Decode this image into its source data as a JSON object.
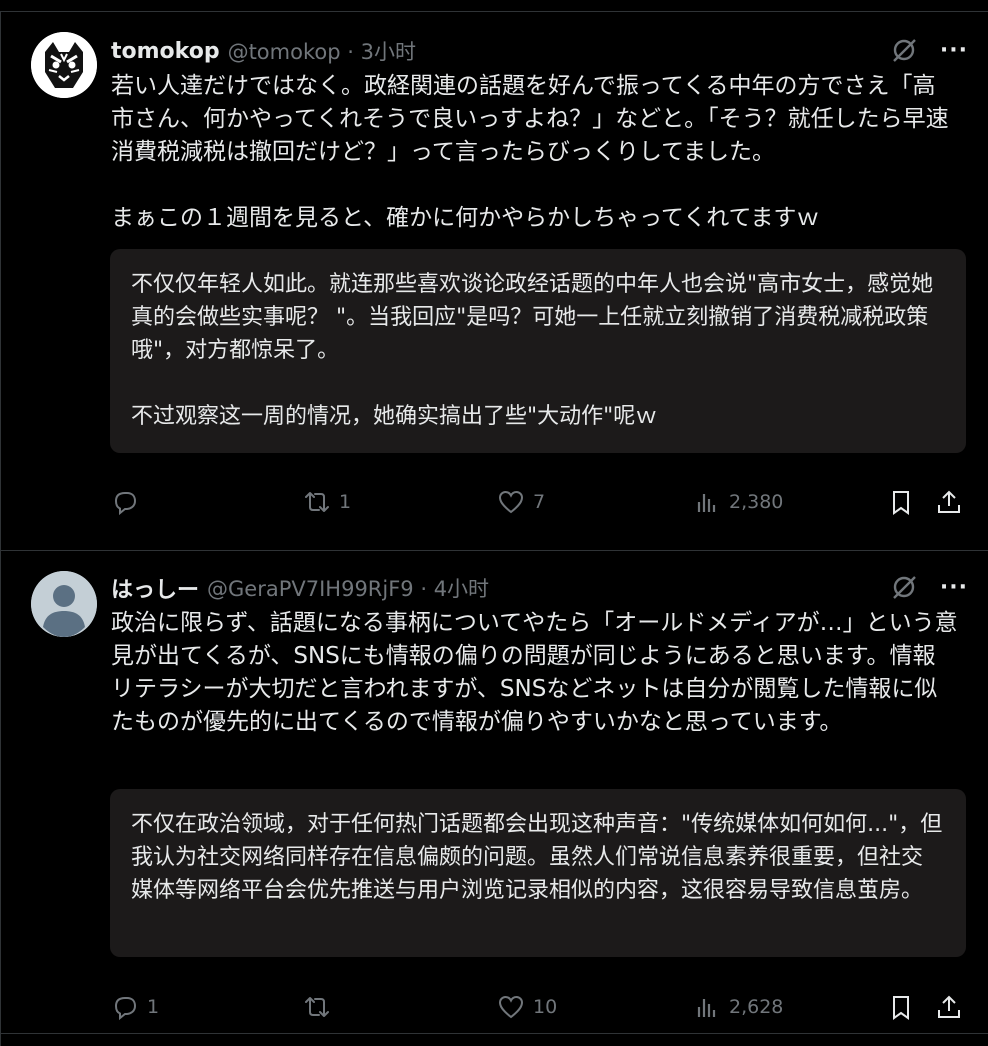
{
  "posts": [
    {
      "name": "tomokop",
      "handle_time": "@tomokop · 3小时",
      "text": "若い人達だけではなく。政経関連の話題を好んで振ってくる中年の方でさえ「高市さん、何かやってくれそうで良いっすよね？」などと。「そう？就任したら早速消費税減税は撤回だけど？」って言ったらびっくりしてました。\n\nまぁこの１週間を見ると、確かに何かやらかしちゃってくれてますｗ",
      "translation": "不仅仅年轻人如此。就连那些喜欢谈论政经话题的中年人也会说\"高市女士，感觉她真的会做些实事呢？ \"。当我回应\"是吗？可她一上任就立刻撤销了消费税减税政策哦\"，对方都惊呆了。\n\n不过观察这一周的情况，她确实搞出了些\"大动作\"呢ｗ",
      "replies": "",
      "reposts": "1",
      "likes": "7",
      "views": "2,380"
    },
    {
      "name": "はっしー",
      "handle_time": "@GeraPV7IH99RjF9 · 4小时",
      "text": "政治に限らず、話題になる事柄についてやたら「オールドメディアが…」という意見が出てくるが、SNSにも情報の偏りの問題が同じようにあると思います。情報リテラシーが大切だと言われますが、SNSなどネットは自分が閲覧した情報に似たものが優先的に出てくるので情報が偏りやすいかなと思っています。",
      "translation": "不仅在政治领域，对于任何热门话题都会出现这种声音：\"传统媒体如何如何...\"，但我认为社交网络同样存在信息偏颇的问题。虽然人们常说信息素养很重要，但社交媒体等网络平台会优先推送与用户浏览记录相似的内容，这很容易导致信息茧房。",
      "replies": "1",
      "reposts": "",
      "likes": "10",
      "views": "2,628"
    }
  ],
  "more_label": "···"
}
